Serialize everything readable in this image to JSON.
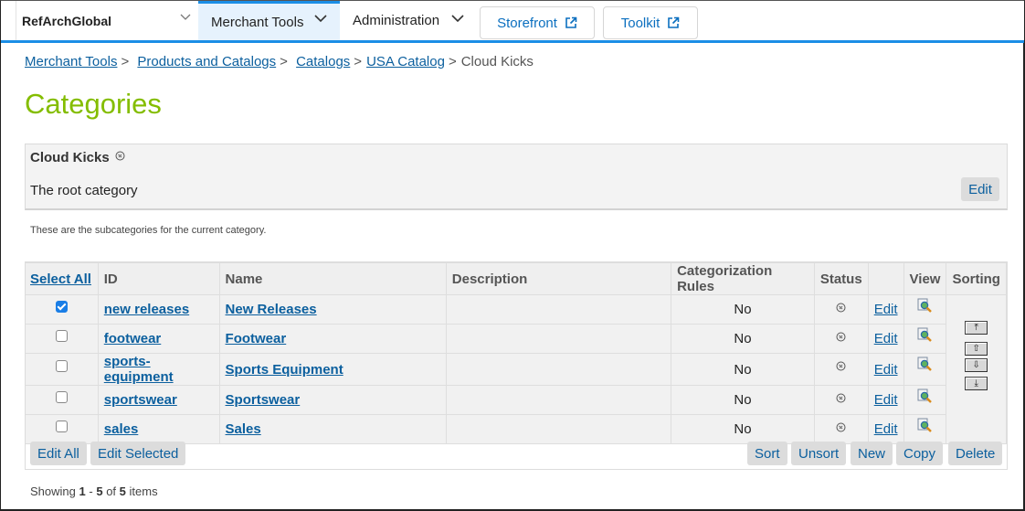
{
  "topnav": {
    "site_selector": {
      "label": "RefArchGlobal",
      "icon": "chevron-down-icon"
    },
    "tabs": [
      {
        "label": "Merchant Tools",
        "active": true,
        "icon": "chevron-down-icon"
      },
      {
        "label": "Administration",
        "active": false,
        "icon": "chevron-down-icon"
      }
    ],
    "external_links": [
      {
        "label": "Storefront",
        "icon": "external-link-icon"
      },
      {
        "label": "Toolkit",
        "icon": "external-link-icon"
      }
    ],
    "accent_color": "#1b8ee6"
  },
  "breadcrumb": [
    {
      "label": "Merchant Tools",
      "link": true
    },
    {
      "label": "Products and Catalogs",
      "link": true
    },
    {
      "label": "Catalogs",
      "link": true
    },
    {
      "label": "USA Catalog",
      "link": true
    },
    {
      "label": "Cloud Kicks",
      "link": false
    }
  ],
  "breadcrumb_separator": ">",
  "page_title": "Categories",
  "title_color": "#84bd00",
  "current_category": {
    "name": "Cloud Kicks",
    "status_icon": "online-status-icon",
    "description": "The root category",
    "edit_label": "Edit"
  },
  "hint": "These are the subcategories for the current category.",
  "table": {
    "columns": [
      "Select All",
      "ID",
      "Name",
      "Description",
      "Categorization Rules",
      "Status",
      "",
      "View",
      "Sorting"
    ],
    "rows": [
      {
        "checked": true,
        "id": "new releases",
        "name": "New Releases",
        "description": "",
        "rules": "No",
        "status_icon": "online-status-icon",
        "edit": "Edit",
        "view_icon": "preview-magnifier-icon"
      },
      {
        "checked": false,
        "id": "footwear",
        "name": "Footwear",
        "description": "",
        "rules": "No",
        "status_icon": "online-status-icon",
        "edit": "Edit",
        "view_icon": "preview-magnifier-icon"
      },
      {
        "checked": false,
        "id": "sports-equipment",
        "name": "Sports Equipment",
        "description": "",
        "rules": "No",
        "status_icon": "online-status-icon",
        "edit": "Edit",
        "view_icon": "preview-magnifier-icon"
      },
      {
        "checked": false,
        "id": "sportswear",
        "name": "Sportswear",
        "description": "",
        "rules": "No",
        "status_icon": "online-status-icon",
        "edit": "Edit",
        "view_icon": "preview-magnifier-icon"
      },
      {
        "checked": false,
        "id": "sales",
        "name": "Sales",
        "description": "",
        "rules": "No",
        "status_icon": "online-status-icon",
        "edit": "Edit",
        "view_icon": "preview-magnifier-icon"
      }
    ],
    "sorting_buttons": [
      {
        "name": "move-to-top",
        "glyph": "⤒"
      },
      {
        "name": "move-up",
        "glyph": "⇧"
      },
      {
        "name": "move-down",
        "glyph": "⇩"
      },
      {
        "name": "move-to-bottom",
        "glyph": "⤓"
      }
    ],
    "left_actions": [
      "Edit All",
      "Edit Selected"
    ],
    "right_actions": [
      "Sort",
      "Unsort",
      "New",
      "Copy",
      "Delete"
    ]
  },
  "pagination": {
    "prefix": "Showing",
    "from": "1",
    "dash": "-",
    "to": "5",
    "of": "of",
    "total": "5",
    "suffix": "items"
  }
}
